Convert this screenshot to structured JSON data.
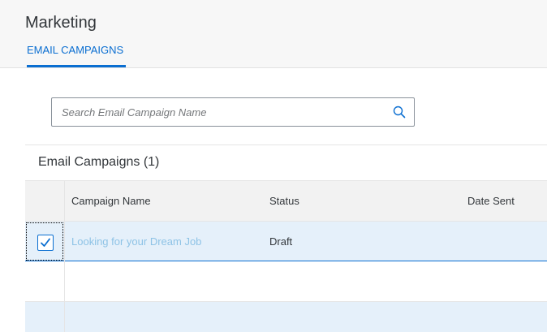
{
  "header": {
    "title": "Marketing",
    "tabs": [
      {
        "label": "EMAIL CAMPAIGNS",
        "selected": true
      }
    ]
  },
  "search": {
    "placeholder": "Search Email Campaign Name",
    "value": "",
    "icon": "search-icon"
  },
  "table": {
    "title": "Email Campaigns (1)",
    "columns": [
      "Campaign Name",
      "Status",
      "Date Sent"
    ],
    "rows": [
      {
        "selected": true,
        "campaign_name": "Looking for your Dream Job",
        "status": "Draft",
        "date_sent": ""
      }
    ]
  },
  "colors": {
    "accent": "#0a6ed1",
    "selected_row": "#e5f0fa",
    "link": "#8ec3e6"
  }
}
